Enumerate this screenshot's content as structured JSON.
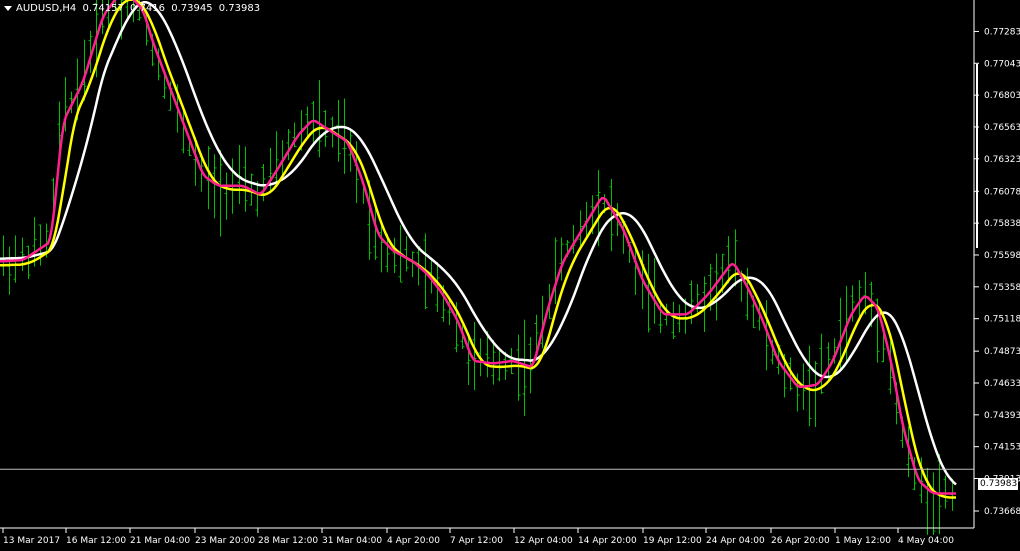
{
  "header": {
    "symbol": "AUDUSD,H4",
    "values": [
      "0.74157",
      "0.7416",
      "0.73945",
      "0.73983"
    ]
  },
  "current_price_label": "0.73983",
  "colors": {
    "background": "#000000",
    "bars": "#00c000",
    "ma_fast": "#ff1f8f",
    "ma_mid": "#ffff00",
    "ma_slow": "#ffffff",
    "axis": "#ffffff"
  },
  "chart_data": {
    "type": "line",
    "ylim": [
      0.7354,
      0.7752
    ],
    "y_ticks": [
      "0.77283",
      "0.77043",
      "0.76803",
      "0.76563",
      "0.76323",
      "0.76078",
      "0.75838",
      "0.75598",
      "0.75358",
      "0.75118",
      "0.74873",
      "0.74633",
      "0.74393",
      "0.74153",
      "0.73913",
      "0.73668"
    ],
    "x_ticks": [
      "13 Mar 2017",
      "16 Mar 12:00",
      "21 Mar 04:00",
      "23 Mar 20:00",
      "28 Mar 12:00",
      "31 Mar 04:00",
      "4 Apr 20:00",
      "7 Apr 12:00",
      "12 Apr 04:00",
      "14 Apr 20:00",
      "19 Apr 12:00",
      "24 Apr 04:00",
      "26 Apr 20:00",
      "1 May 12:00",
      "4 May 04:00"
    ],
    "bar_count": 155,
    "last_price": 0.73983,
    "series": [
      {
        "color": "#ff1f8f",
        "bar_index": [
          0,
          8,
          16,
          24,
          26,
          32,
          40,
          48,
          56,
          64,
          72,
          80,
          86,
          94,
          102,
          110,
          118,
          126,
          134,
          142,
          150,
          156,
          164,
          172,
          180,
          188,
          196,
          204,
          212,
          220,
          228,
          236,
          244,
          252,
          260,
          268,
          276,
          284,
          292,
          300,
          308,
          316,
          324,
          332,
          340,
          348,
          356,
          364,
          372,
          380,
          388,
          396,
          404,
          412,
          420,
          428,
          436,
          444,
          452,
          460,
          468,
          476,
          484,
          492,
          500,
          508,
          516,
          524,
          532,
          540,
          548,
          556,
          564,
          572,
          580,
          588,
          596,
          604,
          612,
          620,
          628,
          636,
          644,
          652,
          660,
          668,
          676,
          684,
          692,
          700,
          708,
          716,
          724,
          732,
          740,
          748,
          756,
          764,
          772,
          780,
          788,
          796,
          804,
          812,
          820,
          828,
          836,
          844,
          852,
          860,
          868,
          876,
          884,
          892,
          900,
          908,
          916,
          924,
          932,
          940,
          948,
          956
        ],
        "values": [
          0.7555,
          0.7556,
          0.7557,
          0.7558,
          0.7559,
          0.7563,
          0.7573,
          0.7606,
          0.765,
          0.7688,
          0.7713,
          0.7726,
          0.774,
          0.7766,
          0.7752,
          0.774,
          0.772,
          0.77,
          0.7675,
          0.7665,
          0.765,
          0.7635,
          0.7625,
          0.7612,
          0.7612,
          0.7611,
          0.7606,
          0.7622,
          0.7638,
          0.765,
          0.766,
          0.7662,
          0.7656,
          0.765,
          0.7643,
          0.7618,
          0.7588,
          0.7566,
          0.7556,
          0.7549,
          0.7543,
          0.7535,
          0.7513,
          0.7495,
          0.748,
          0.7478,
          0.7478,
          0.7477,
          0.748,
          0.7479,
          0.7478,
          0.7476,
          0.7482,
          0.751,
          0.7543,
          0.7562,
          0.7574,
          0.7582,
          0.7593,
          0.7604,
          0.7606,
          0.7596,
          0.7568,
          0.7537,
          0.7521,
          0.7512,
          0.7513,
          0.7516,
          0.7523,
          0.7532,
          0.7545,
          0.7556,
          0.7552,
          0.753,
          0.75,
          0.748,
          0.7467,
          0.7461,
          0.7462,
          0.7468,
          0.748,
          0.7502,
          0.752,
          0.753,
          0.753,
          0.752,
          0.7508,
          0.7489,
          0.7459,
          0.743,
          0.7408,
          0.739,
          0.7384,
          0.7381,
          0.7384,
          0.7382,
          0.738,
          0.7382,
          0.7383,
          0.738,
          0.738,
          0.738,
          0.7381,
          0.738,
          0.7379,
          0.738,
          0.7379,
          0.7381,
          0.7382,
          0.738,
          0.7381,
          0.738,
          0.738,
          0.7379,
          0.738,
          0.7379,
          0.738,
          0.7381,
          0.738,
          0.7379,
          0.738,
          0.738,
          0.738
        ]
      },
      {
        "color": "#ffff00",
        "values": []
      },
      {
        "color": "#ffffff",
        "values": []
      }
    ]
  }
}
